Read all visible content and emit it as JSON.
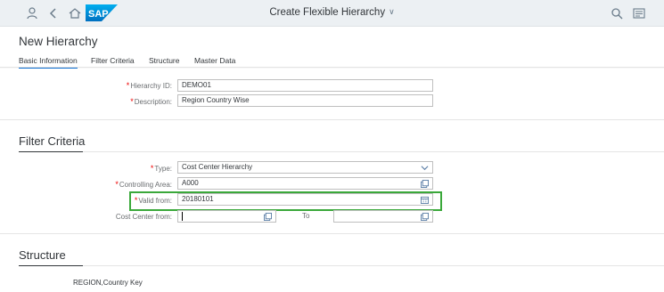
{
  "shell": {
    "title": "Create Flexible Hierarchy",
    "logo_text": "SAP",
    "icons": [
      "user-icon",
      "back-icon",
      "home-icon",
      "search-icon",
      "notifications-icon"
    ]
  },
  "page": {
    "title": "New Hierarchy",
    "tabs": [
      {
        "label": "Basic Information",
        "active": true
      },
      {
        "label": "Filter Criteria",
        "active": false
      },
      {
        "label": "Structure",
        "active": false
      },
      {
        "label": "Master Data",
        "active": false
      }
    ]
  },
  "basic": {
    "hierarchy_id_label": "Hierarchy ID:",
    "hierarchy_id_value": "DEMO01",
    "description_label": "Description:",
    "description_value": "Region Country Wise"
  },
  "filter": {
    "section_title": "Filter Criteria",
    "type_label": "Type:",
    "type_value": "Cost Center Hierarchy",
    "controlling_area_label": "Controlling Area:",
    "controlling_area_value": "A000",
    "valid_from_label": "Valid from:",
    "valid_from_value": "20180101",
    "cost_center_from_label": "Cost Center from:",
    "cost_center_from_value": "",
    "to_label": "To",
    "cost_center_to_value": ""
  },
  "structure": {
    "section_title": "Structure",
    "key_text": "REGION,Country Key"
  },
  "colors": {
    "accent": "#0a6ed1",
    "required": "#ee0000",
    "highlight": "#3aa83a"
  }
}
